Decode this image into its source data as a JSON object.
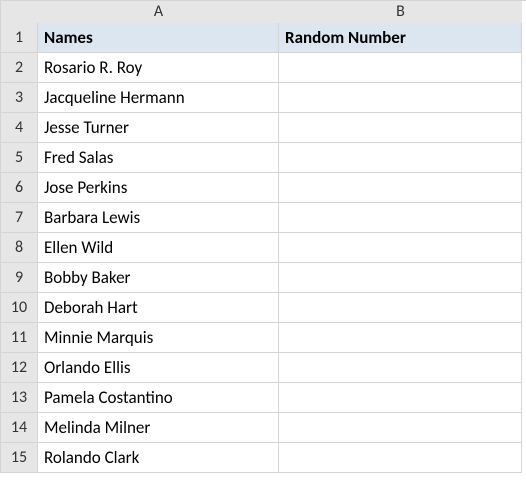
{
  "columns": [
    "A",
    "B"
  ],
  "rows": [
    "1",
    "2",
    "3",
    "4",
    "5",
    "6",
    "7",
    "8",
    "9",
    "10",
    "11",
    "12",
    "13",
    "14",
    "15"
  ],
  "headers": {
    "A": "Names",
    "B": "Random Number"
  },
  "data": {
    "A": [
      "Rosario R. Roy",
      "Jacqueline Hermann",
      "Jesse Turner",
      "Fred Salas",
      "Jose Perkins",
      "Barbara Lewis",
      "Ellen Wild",
      "Bobby Baker",
      "Deborah Hart",
      "Minnie Marquis",
      "Orlando Ellis",
      "Pamela Costantino",
      "Melinda Milner",
      "Rolando Clark"
    ],
    "B": [
      "",
      "",
      "",
      "",
      "",
      "",
      "",
      "",
      "",
      "",
      "",
      "",
      "",
      ""
    ]
  }
}
